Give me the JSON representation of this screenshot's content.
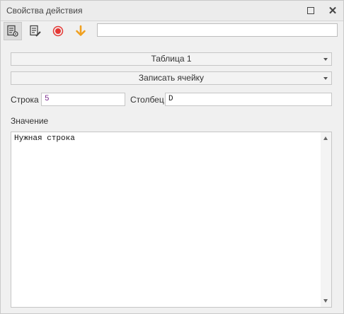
{
  "window": {
    "title": "Свойства действия",
    "icons": {
      "maximize": "maximize-icon",
      "close": "close-icon"
    }
  },
  "toolbar": {
    "tools": [
      {
        "name": "settings-props",
        "icon": "document-gear-icon",
        "active": true
      },
      {
        "name": "edit-props",
        "icon": "document-pencil-icon",
        "active": false
      },
      {
        "name": "record",
        "icon": "record-icon",
        "color": "#e53935"
      },
      {
        "name": "download",
        "icon": "arrow-down-icon",
        "color": "#f0a020"
      }
    ],
    "search_value": ""
  },
  "form": {
    "table_select": "Таблица 1",
    "action_select": "Записать ячейку",
    "row_label": "Строка",
    "row_value": "5",
    "col_label": "Столбец",
    "col_value": "D",
    "value_label": "Значение",
    "value_text": "Нужная строка"
  }
}
